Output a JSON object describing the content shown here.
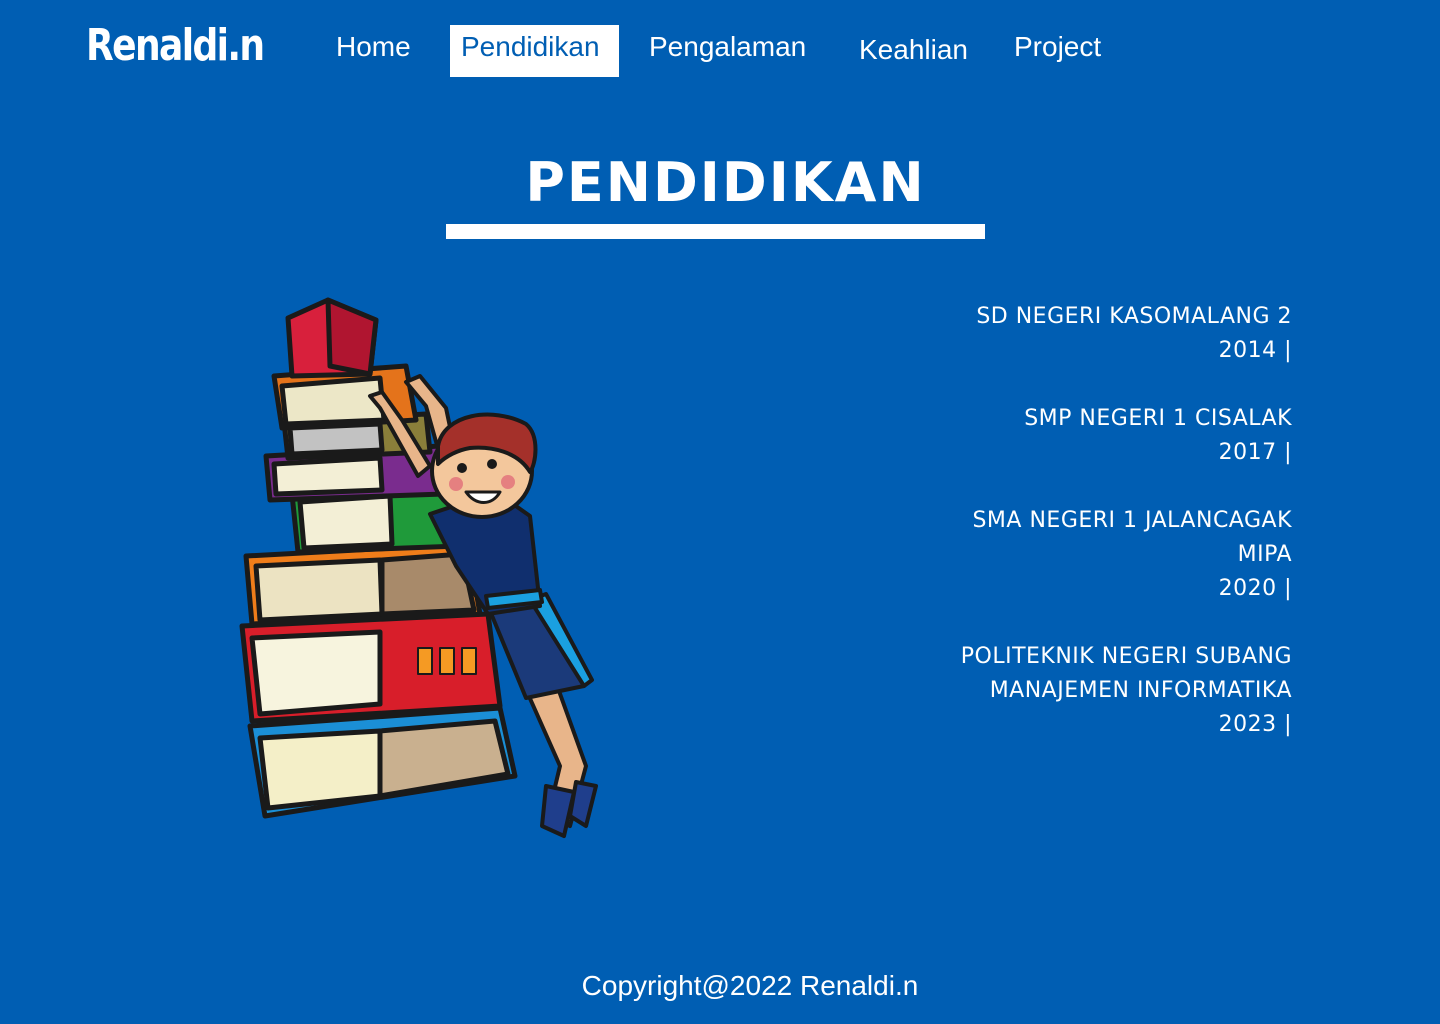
{
  "navbar": {
    "brand": "Renaldi.n",
    "items": [
      {
        "label": "Home",
        "active": false
      },
      {
        "label": "Pendidikan",
        "active": true
      },
      {
        "label": "Pengalaman",
        "active": false
      },
      {
        "label": "Keahlian",
        "active": false
      },
      {
        "label": "Project",
        "active": false
      }
    ]
  },
  "section": {
    "title": "PENDIDIKAN"
  },
  "education": [
    {
      "school": "SD NEGERI KASOMALANG 2",
      "major": "",
      "year": "2014 |"
    },
    {
      "school": "SMP NEGERI 1 CISALAK",
      "major": "",
      "year": "2017 |"
    },
    {
      "school": "SMA NEGERI 1 JALANCAGAK",
      "major": "MIPA",
      "year": "2020 |"
    },
    {
      "school": "POLITEKNIK NEGERI SUBANG",
      "major": "MANAJEMEN INFORMATIKA",
      "year": "2023 |"
    }
  ],
  "footer": {
    "copyright": "Copyright@2022 Renaldi.n"
  },
  "colors": {
    "background": "#005eb3",
    "text": "#ffffff",
    "active_nav_bg": "#ffffff"
  }
}
